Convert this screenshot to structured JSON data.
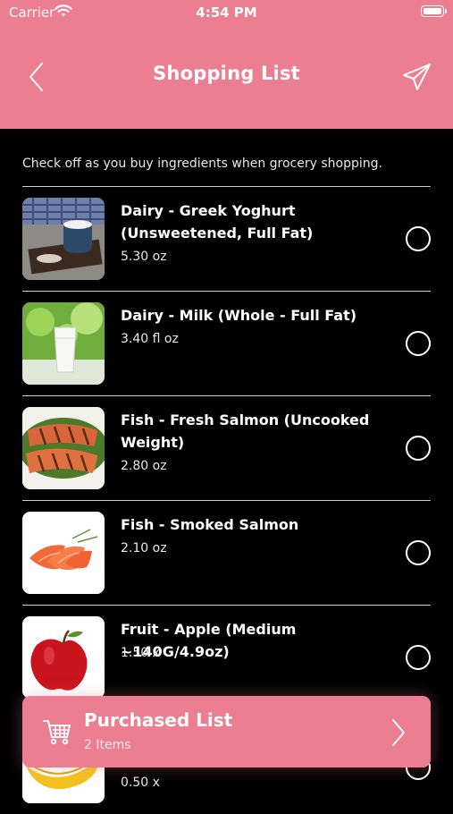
{
  "status_bar": {
    "carrier": "Carrier",
    "time": "4:54 PM"
  },
  "header": {
    "title": "Shopping List",
    "accent_color": "#ec7e92"
  },
  "instruction": "Check off as you buy ingredients when grocery shopping.",
  "items": [
    {
      "name": "Dairy - Greek Yoghurt (Unsweetened, Full Fat)",
      "quantity": "5.30 oz",
      "checked": false
    },
    {
      "name": "Dairy - Milk (Whole - Full Fat)",
      "quantity": "3.40 fl oz",
      "checked": false
    },
    {
      "name": "Fish - Fresh Salmon (Uncooked Weight)",
      "quantity": "2.80 oz",
      "checked": false
    },
    {
      "name": "Fish - Smoked Salmon",
      "quantity": "2.10 oz",
      "checked": false
    },
    {
      "name": "Fruit - Apple (Medium ~140G/4.9oz)",
      "quantity": "1.50 x",
      "checked": false
    },
    {
      "name": "",
      "quantity": "0.50 x",
      "checked": false
    }
  ],
  "purchased_list": {
    "title": "Purchased List",
    "count_label": "2 Items"
  }
}
